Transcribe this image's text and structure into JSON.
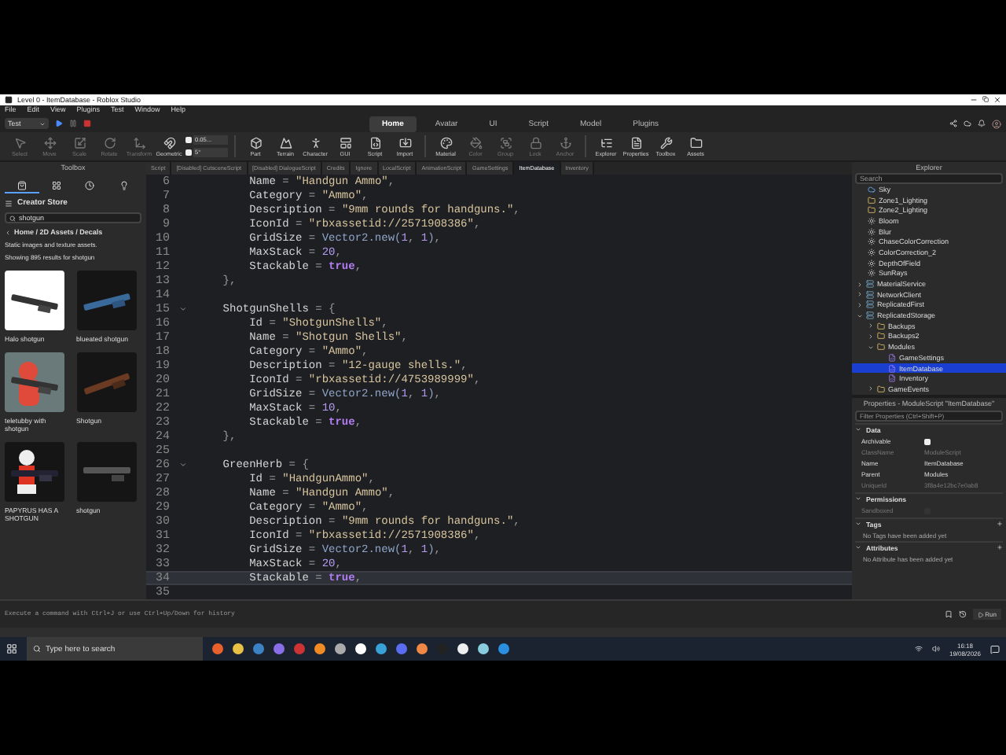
{
  "window": {
    "title": "Level 0 - ItemDatabase - Roblox Studio"
  },
  "menu": [
    "File",
    "Edit",
    "View",
    "Plugins",
    "Test",
    "Window",
    "Help"
  ],
  "mode_dropdown": "Test",
  "top_tabs": [
    {
      "label": "Home",
      "selected": true
    },
    {
      "label": "Avatar",
      "selected": false
    },
    {
      "label": "UI",
      "selected": false
    },
    {
      "label": "Script",
      "selected": false
    },
    {
      "label": "Model",
      "selected": false
    },
    {
      "label": "Plugins",
      "selected": false
    }
  ],
  "ribbon": [
    {
      "label": "Select",
      "kind": "select",
      "disabled": true
    },
    {
      "label": "Move",
      "kind": "move",
      "disabled": true
    },
    {
      "label": "Scale",
      "kind": "scale",
      "disabled": true
    },
    {
      "label": "Rotate",
      "kind": "rotate",
      "disabled": true
    },
    {
      "label": "Transform",
      "kind": "transform",
      "disabled": true
    },
    {
      "label": "Geometric",
      "kind": "geometric",
      "disabled": false
    },
    {
      "label": "Part",
      "kind": "part",
      "disabled": false
    },
    {
      "label": "Terrain",
      "kind": "terrain",
      "disabled": false
    },
    {
      "label": "Character",
      "kind": "character",
      "disabled": false
    },
    {
      "label": "GUI",
      "kind": "gui",
      "disabled": false
    },
    {
      "label": "Script",
      "kind": "script",
      "disabled": false
    },
    {
      "label": "Import",
      "kind": "import",
      "disabled": false
    },
    {
      "label": "Material",
      "kind": "material",
      "disabled": false
    },
    {
      "label": "Color",
      "kind": "color",
      "disabled": true
    },
    {
      "label": "Group",
      "kind": "group",
      "disabled": true
    },
    {
      "label": "Lock",
      "kind": "lock",
      "disabled": true
    },
    {
      "label": "Anchor",
      "kind": "anchor",
      "disabled": true
    },
    {
      "label": "Explorer",
      "kind": "explorer",
      "disabled": false
    },
    {
      "label": "Properties",
      "kind": "properties",
      "disabled": false
    },
    {
      "label": "Toolbox",
      "kind": "toolbox",
      "disabled": false
    },
    {
      "label": "Assets",
      "kind": "assets",
      "disabled": false
    }
  ],
  "snap_fields": [
    {
      "value": "0.05...",
      "checked": true
    },
    {
      "value": "5°",
      "checked": true
    }
  ],
  "toolbox": {
    "title": "Toolbox",
    "tabs": [
      {
        "kind": "store",
        "selected": true
      },
      {
        "kind": "grid",
        "selected": false
      },
      {
        "kind": "clock",
        "selected": false
      },
      {
        "kind": "bulb",
        "selected": false
      }
    ],
    "store": "Creator Store",
    "search": "shotgun",
    "breadcrumb": "Home / 2D Assets / Decals",
    "subtitle": "Static images and texture assets.",
    "results": "Showing 895 results for shotgun",
    "items": [
      {
        "name": "Halo shotgun",
        "kind": "picture"
      },
      {
        "name": "blueated shotgun",
        "kind": "picture"
      },
      {
        "name": "teletubby with shotgun",
        "kind": "picture"
      },
      {
        "name": "Shotgun",
        "kind": "picture"
      },
      {
        "name": "PAPYRUS HAS A SHOTGUN",
        "kind": "picture"
      },
      {
        "name": "shotgun",
        "kind": "picture"
      }
    ]
  },
  "script_tabs": [
    {
      "label": "Script",
      "selected": false
    },
    {
      "label": "[Disabled] CutsceneScript",
      "selected": false
    },
    {
      "label": "[Disabled] DialogueScript",
      "selected": false
    },
    {
      "label": "Credits",
      "selected": false
    },
    {
      "label": "Ignore",
      "selected": false
    },
    {
      "label": "LocalScript",
      "selected": false
    },
    {
      "label": "AnimationScript",
      "selected": false
    },
    {
      "label": "GameSettings",
      "selected": false
    },
    {
      "label": "ItemDatabase",
      "selected": true
    },
    {
      "label": "Inventory",
      "selected": false
    }
  ],
  "code": [
    {
      "n": "6",
      "fold": false,
      "current": false,
      "t": [
        {
          "kind": "id",
          "text": "        Name"
        },
        {
          "kind": "op",
          "text": " = "
        },
        {
          "kind": "str",
          "text": "\"Handgun Ammo\""
        },
        {
          "kind": "op",
          "text": ","
        }
      ]
    },
    {
      "n": "7",
      "fold": false,
      "current": false,
      "t": [
        {
          "kind": "id",
          "text": "        Category"
        },
        {
          "kind": "op",
          "text": " = "
        },
        {
          "kind": "str",
          "text": "\"Ammo\""
        },
        {
          "kind": "op",
          "text": ","
        }
      ]
    },
    {
      "n": "8",
      "fold": false,
      "current": false,
      "t": [
        {
          "kind": "id",
          "text": "        Description"
        },
        {
          "kind": "op",
          "text": " = "
        },
        {
          "kind": "str",
          "text": "\"9mm rounds for handguns.\""
        },
        {
          "kind": "op",
          "text": ","
        }
      ]
    },
    {
      "n": "9",
      "fold": false,
      "current": false,
      "t": [
        {
          "kind": "id",
          "text": "        IconId"
        },
        {
          "kind": "op",
          "text": " = "
        },
        {
          "kind": "str",
          "text": "\"rbxassetid://2571908386\""
        },
        {
          "kind": "op",
          "text": ","
        }
      ]
    },
    {
      "n": "10",
      "fold": false,
      "current": false,
      "t": [
        {
          "kind": "id",
          "text": "        GridSize"
        },
        {
          "kind": "op",
          "text": " = "
        },
        {
          "kind": "fn",
          "text": "Vector2.new("
        },
        {
          "kind": "num",
          "text": "1"
        },
        {
          "kind": "op",
          "text": ", "
        },
        {
          "kind": "num",
          "text": "1"
        },
        {
          "kind": "fn",
          "text": ")"
        },
        {
          "kind": "op",
          "text": ","
        }
      ]
    },
    {
      "n": "11",
      "fold": false,
      "current": false,
      "t": [
        {
          "kind": "id",
          "text": "        MaxStack"
        },
        {
          "kind": "op",
          "text": " = "
        },
        {
          "kind": "num",
          "text": "20"
        },
        {
          "kind": "op",
          "text": ","
        }
      ]
    },
    {
      "n": "12",
      "fold": false,
      "current": false,
      "t": [
        {
          "kind": "id",
          "text": "        Stackable"
        },
        {
          "kind": "op",
          "text": " = "
        },
        {
          "kind": "kw",
          "text": "true"
        },
        {
          "kind": "op",
          "text": ","
        }
      ]
    },
    {
      "n": "13",
      "fold": false,
      "current": false,
      "t": [
        {
          "kind": "op",
          "text": "    },"
        }
      ]
    },
    {
      "n": "14",
      "fold": false,
      "current": false
    },
    {
      "n": "15",
      "fold": true,
      "current": false,
      "t": [
        {
          "kind": "id",
          "text": "    ShotgunShells"
        },
        {
          "kind": "op",
          "text": " = {"
        }
      ]
    },
    {
      "n": "16",
      "fold": false,
      "current": false,
      "t": [
        {
          "kind": "id",
          "text": "        Id"
        },
        {
          "kind": "op",
          "text": " = "
        },
        {
          "kind": "str",
          "text": "\"ShotgunShells\""
        },
        {
          "kind": "op",
          "text": ","
        }
      ]
    },
    {
      "n": "17",
      "fold": false,
      "current": false,
      "t": [
        {
          "kind": "id",
          "text": "        Name"
        },
        {
          "kind": "op",
          "text": " = "
        },
        {
          "kind": "str",
          "text": "\"Shotgun Shells\""
        },
        {
          "kind": "op",
          "text": ","
        }
      ]
    },
    {
      "n": "18",
      "fold": false,
      "current": false,
      "t": [
        {
          "kind": "id",
          "text": "        Category"
        },
        {
          "kind": "op",
          "text": " = "
        },
        {
          "kind": "str",
          "text": "\"Ammo\""
        },
        {
          "kind": "op",
          "text": ","
        }
      ]
    },
    {
      "n": "19",
      "fold": false,
      "current": false,
      "t": [
        {
          "kind": "id",
          "text": "        Description"
        },
        {
          "kind": "op",
          "text": " = "
        },
        {
          "kind": "str",
          "text": "\"12-gauge shells.\""
        },
        {
          "kind": "op",
          "text": ","
        }
      ]
    },
    {
      "n": "20",
      "fold": false,
      "current": false,
      "t": [
        {
          "kind": "id",
          "text": "        IconId"
        },
        {
          "kind": "op",
          "text": " = "
        },
        {
          "kind": "str",
          "text": "\"rbxassetid://4753989999\""
        },
        {
          "kind": "op",
          "text": ","
        }
      ]
    },
    {
      "n": "21",
      "fold": false,
      "current": false,
      "t": [
        {
          "kind": "id",
          "text": "        GridSize"
        },
        {
          "kind": "op",
          "text": " = "
        },
        {
          "kind": "fn",
          "text": "Vector2.new("
        },
        {
          "kind": "num",
          "text": "1"
        },
        {
          "kind": "op",
          "text": ", "
        },
        {
          "kind": "num",
          "text": "1"
        },
        {
          "kind": "fn",
          "text": ")"
        },
        {
          "kind": "op",
          "text": ","
        }
      ]
    },
    {
      "n": "22",
      "fold": false,
      "current": false,
      "t": [
        {
          "kind": "id",
          "text": "        MaxStack"
        },
        {
          "kind": "op",
          "text": " = "
        },
        {
          "kind": "num",
          "text": "10"
        },
        {
          "kind": "op",
          "text": ","
        }
      ]
    },
    {
      "n": "23",
      "fold": false,
      "current": false,
      "t": [
        {
          "kind": "id",
          "text": "        Stackable"
        },
        {
          "kind": "op",
          "text": " = "
        },
        {
          "kind": "kw",
          "text": "true"
        },
        {
          "kind": "op",
          "text": ","
        }
      ]
    },
    {
      "n": "24",
      "fold": false,
      "current": false,
      "t": [
        {
          "kind": "op",
          "text": "    },"
        }
      ]
    },
    {
      "n": "25",
      "fold": false,
      "current": false
    },
    {
      "n": "26",
      "fold": true,
      "current": false,
      "t": [
        {
          "kind": "id",
          "text": "    GreenHerb"
        },
        {
          "kind": "op",
          "text": " = {"
        }
      ]
    },
    {
      "n": "27",
      "fold": false,
      "current": false,
      "t": [
        {
          "kind": "id",
          "text": "        Id"
        },
        {
          "kind": "op",
          "text": " = "
        },
        {
          "kind": "str",
          "text": "\"HandgunAmmo\""
        },
        {
          "kind": "op",
          "text": ","
        }
      ]
    },
    {
      "n": "28",
      "fold": false,
      "current": false,
      "t": [
        {
          "kind": "id",
          "text": "        Name"
        },
        {
          "kind": "op",
          "text": " = "
        },
        {
          "kind": "str",
          "text": "\"Handgun Ammo\""
        },
        {
          "kind": "op",
          "text": ","
        }
      ]
    },
    {
      "n": "29",
      "fold": false,
      "current": false,
      "t": [
        {
          "kind": "id",
          "text": "        Category"
        },
        {
          "kind": "op",
          "text": " = "
        },
        {
          "kind": "str",
          "text": "\"Ammo\""
        },
        {
          "kind": "op",
          "text": ","
        }
      ]
    },
    {
      "n": "30",
      "fold": false,
      "current": false,
      "t": [
        {
          "kind": "id",
          "text": "        Description"
        },
        {
          "kind": "op",
          "text": " = "
        },
        {
          "kind": "str",
          "text": "\"9mm rounds for handguns.\""
        },
        {
          "kind": "op",
          "text": ","
        }
      ]
    },
    {
      "n": "31",
      "fold": false,
      "current": false,
      "t": [
        {
          "kind": "id",
          "text": "        IconId"
        },
        {
          "kind": "op",
          "text": " = "
        },
        {
          "kind": "str",
          "text": "\"rbxassetid://2571908386\""
        },
        {
          "kind": "op",
          "text": ","
        }
      ]
    },
    {
      "n": "32",
      "fold": false,
      "current": false,
      "t": [
        {
          "kind": "id",
          "text": "        GridSize"
        },
        {
          "kind": "op",
          "text": " = "
        },
        {
          "kind": "fn",
          "text": "Vector2.new("
        },
        {
          "kind": "num",
          "text": "1"
        },
        {
          "kind": "op",
          "text": ", "
        },
        {
          "kind": "num",
          "text": "1"
        },
        {
          "kind": "fn",
          "text": ")"
        },
        {
          "kind": "op",
          "text": ","
        }
      ]
    },
    {
      "n": "33",
      "fold": false,
      "current": false,
      "t": [
        {
          "kind": "id",
          "text": "        MaxStack"
        },
        {
          "kind": "op",
          "text": " = "
        },
        {
          "kind": "num",
          "text": "20"
        },
        {
          "kind": "op",
          "text": ","
        }
      ]
    },
    {
      "n": "34",
      "fold": false,
      "current": true,
      "t": [
        {
          "kind": "id",
          "text": "        Stackable"
        },
        {
          "kind": "op",
          "text": " = "
        },
        {
          "kind": "kw",
          "text": "true"
        },
        {
          "kind": "op",
          "text": ","
        }
      ]
    },
    {
      "n": "35",
      "fold": false,
      "current": false
    }
  ],
  "explorer": {
    "title": "Explorer",
    "search_placeholder": "Search",
    "partial_items": [
      {
        "label": "Sky",
        "kind": "sky"
      },
      {
        "label": "Zone1_Lighting",
        "kind": "folder"
      },
      {
        "label": "Zone2_Lighting",
        "kind": "folder"
      },
      {
        "label": "Bloom",
        "kind": "effect"
      },
      {
        "label": "Blur",
        "kind": "effect"
      },
      {
        "label": "ChaseColorCorrection",
        "kind": "effect"
      },
      {
        "label": "ColorCorrection_2",
        "kind": "effect"
      },
      {
        "label": "DepthOfField",
        "kind": "effect"
      },
      {
        "label": "SunRays",
        "kind": "effect"
      }
    ],
    "items": [
      {
        "label": "MaterialService",
        "kind": "service",
        "expanded": false,
        "selected": false
      },
      {
        "label": "NetworkClient",
        "kind": "service",
        "expanded": false,
        "selected": false
      },
      {
        "label": "ReplicatedFirst",
        "kind": "service",
        "expanded": false,
        "selected": false
      },
      {
        "label": "ReplicatedStorage",
        "kind": "service",
        "expanded": true,
        "selected": false,
        "children": [
          {
            "label": "Backups",
            "kind": "folder",
            "expanded": false,
            "selected": false
          },
          {
            "label": "Backups2",
            "kind": "folder",
            "expanded": false,
            "selected": false
          },
          {
            "label": "Modules",
            "kind": "folder",
            "expanded": true,
            "selected": false,
            "children": [
              {
                "label": "GameSettings",
                "kind": "script",
                "selected": false
              },
              {
                "label": "ItemDatabase",
                "kind": "script",
                "selected": true
              },
              {
                "label": "Inventory",
                "kind": "script",
                "selected": false
              }
            ]
          },
          {
            "label": "GameEvents",
            "kind": "folder",
            "expanded": false,
            "selected": false
          }
        ]
      }
    ]
  },
  "properties": {
    "title": "Properties - ModuleScript \"ItemDatabase\"",
    "filter_placeholder": "Filter Properties (Ctrl+Shift+P)",
    "sections": [
      {
        "title": "Data",
        "rows": [
          {
            "name": "Archivable",
            "kind": "checkbox",
            "checked": true,
            "disabled": false
          },
          {
            "name": "ClassName",
            "kind": "text",
            "value": "ModuleScript",
            "disabled": true
          },
          {
            "name": "Name",
            "kind": "text",
            "value": "ItemDatabase",
            "disabled": false
          },
          {
            "name": "Parent",
            "kind": "text",
            "value": "Modules",
            "disabled": false
          },
          {
            "name": "UniqueId",
            "kind": "text",
            "value": "3f8a4e12bc7e0ab8",
            "disabled": true
          }
        ]
      },
      {
        "title": "Permissions",
        "rows": [
          {
            "name": "Sandboxed",
            "kind": "checkbox",
            "checked": false,
            "disabled": true
          }
        ]
      },
      {
        "title": "Tags",
        "add": true,
        "empty": "No Tags have been added yet"
      },
      {
        "title": "Attributes",
        "add": true,
        "empty": "No Attribute has been added yet"
      }
    ]
  },
  "command_bar": {
    "placeholder": "Execute a command with Ctrl+J or use Ctrl+Up/Down for history",
    "run": "Run"
  },
  "taskbar": {
    "search_placeholder": "Type here to search",
    "time": "16:18",
    "date": "19/08/2026"
  }
}
